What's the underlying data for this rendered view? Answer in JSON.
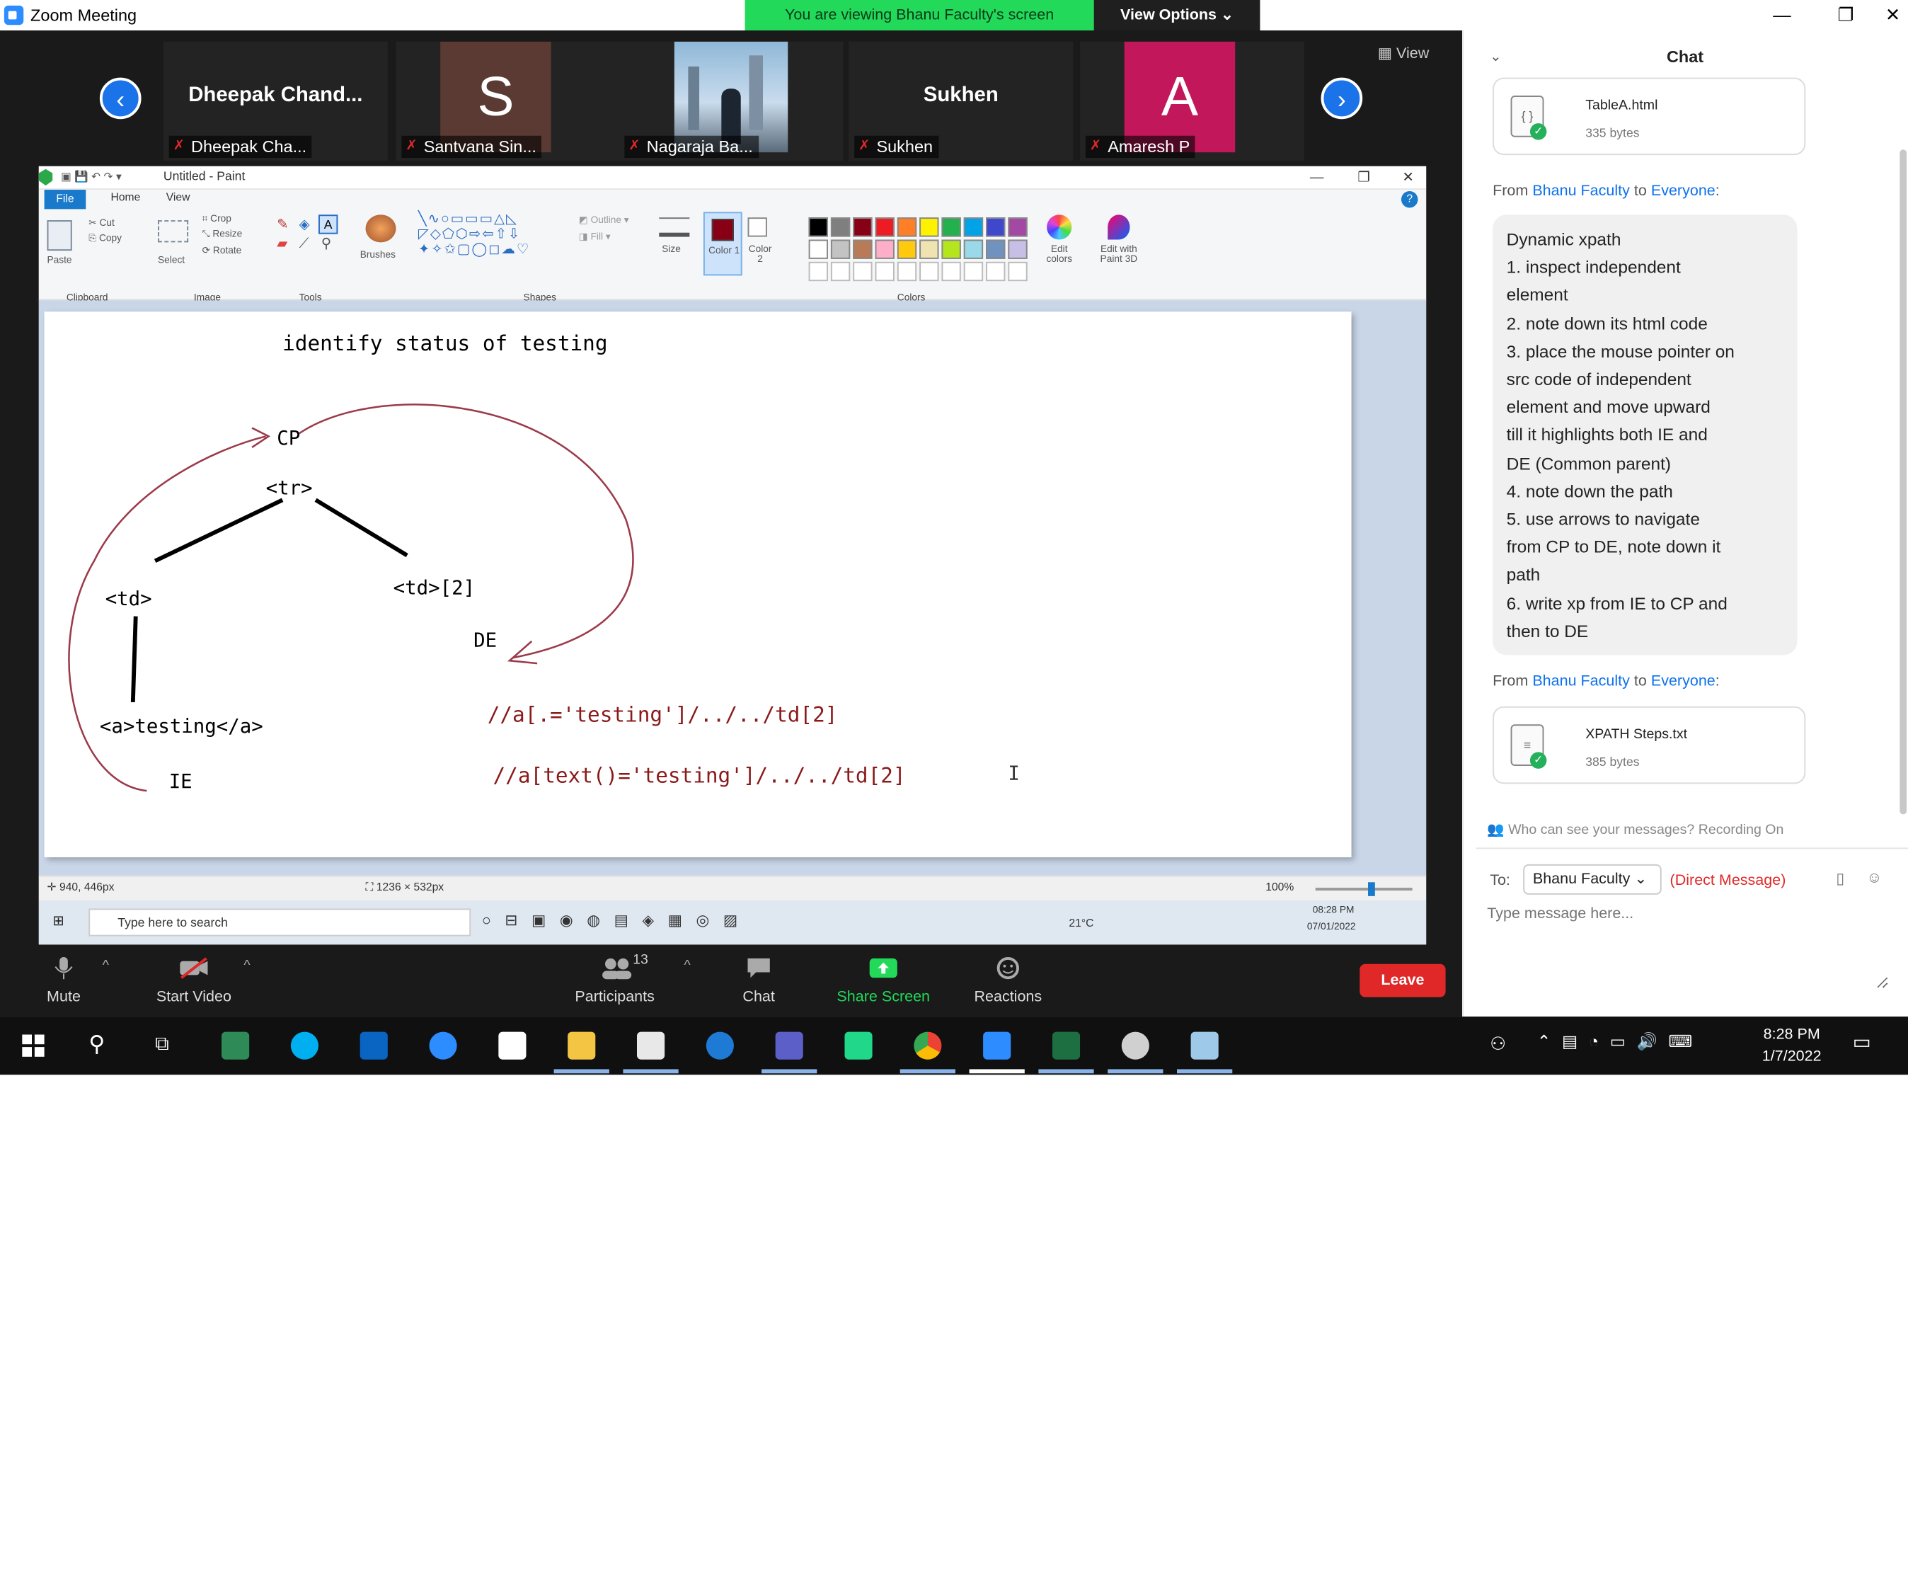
{
  "zoom": {
    "title": "Zoom Meeting",
    "banner_text": "You are viewing Bhanu Faculty's screen",
    "view_options": "View Options ⌄",
    "view_label": "View"
  },
  "gallery": {
    "participants": [
      {
        "big_name": "Dheepak  Chand...",
        "label": "Dheepak Cha..."
      },
      {
        "avatar_letter": "S",
        "label": "Santvana Sin..."
      },
      {
        "label": "Nagaraja Ba..."
      },
      {
        "big_name": "Sukhen",
        "label": "Sukhen"
      },
      {
        "avatar_letter": "A",
        "label": "Amaresh P"
      }
    ]
  },
  "paint": {
    "window_title": "Untitled - Paint",
    "tabs": [
      "File",
      "Home",
      "View"
    ],
    "groups": [
      "Clipboard",
      "Image",
      "Tools",
      "Shapes",
      "Colors"
    ],
    "clipboard": {
      "paste": "Paste",
      "cut": "Cut",
      "copy": "Copy"
    },
    "image": {
      "select": "Select",
      "crop": "Crop",
      "resize": "Resize",
      "rotate": "Rotate"
    },
    "brushes": "Brushes",
    "outline": "Outline",
    "fill": "Fill",
    "size": "Size",
    "color1": "Color 1",
    "color2": "Color 2",
    "edit_colors": "Edit colors",
    "edit_3d": "Edit with Paint 3D",
    "palette": [
      "#000000",
      "#7f7f7f",
      "#880015",
      "#ed1c24",
      "#ff7f27",
      "#fff200",
      "#22b14c",
      "#00a2e8",
      "#3f48cc",
      "#a349a4",
      "#ffffff",
      "#c3c3c3",
      "#b97a57",
      "#ffaec9",
      "#ffc90e",
      "#efe4b0",
      "#b5e61d",
      "#99d9ea",
      "#7092be",
      "#c8bfe7"
    ],
    "canvas": {
      "heading": "identify status of testing",
      "cp": "CP",
      "tr": "<tr>",
      "td": "<td>",
      "td2": "<td>[2]",
      "de": "DE",
      "a": "<a>testing</a>",
      "ie": "IE",
      "xpath1": "//a[.='testing']/../../td[2]",
      "xpath2": "//a[text()='testing']/../../td[2]",
      "cursor": "I"
    },
    "status": {
      "position": "940, 446px",
      "size": "1236 × 532px",
      "zoom": "100%"
    },
    "inner_taskbar": {
      "search": "Type here to search",
      "temp": "21°C",
      "time": "08:28 PM",
      "date": "07/01/2022"
    }
  },
  "controls": {
    "mute": "Mute",
    "start_video": "Start Video",
    "participants": "Participants",
    "participant_count": "13",
    "chat": "Chat",
    "share_screen": "Share Screen",
    "reactions": "Reactions",
    "leave": "Leave"
  },
  "chat": {
    "header": "Chat",
    "file1": {
      "name": "TableA.html",
      "size": "335 bytes"
    },
    "msg1_from": {
      "prefix": "From ",
      "sender": "Bhanu Faculty",
      "mid": " to ",
      "target": "Everyone",
      "suffix": ":"
    },
    "message_lines": [
      "Dynamic xpath",
      "1. inspect independent",
      "element",
      "2. note down its html code",
      "3. place the mouse pointer on",
      "src code of independent",
      "element and move upward",
      "    till it highlights both IE and",
      "DE (Common parent)",
      "4. note down the path",
      "5. use arrows to navigate",
      "from CP to DE, note down it",
      "path",
      "6. write xp from IE to CP and",
      "then to DE"
    ],
    "msg2_from": {
      "prefix": "From ",
      "sender": "Bhanu Faculty",
      "mid": " to ",
      "target": "Everyone",
      "suffix": ":"
    },
    "file2": {
      "name": "XPATH Steps.txt",
      "size": "385 bytes"
    },
    "who_can_see": "Who can see your messages? Recording On",
    "to_label": "To:",
    "to_value": "Bhanu Faculty ⌄",
    "direct": "(Direct Message)",
    "placeholder": "Type message here..."
  },
  "taskbar": {
    "time": "8:28 PM",
    "date": "1/7/2022"
  }
}
